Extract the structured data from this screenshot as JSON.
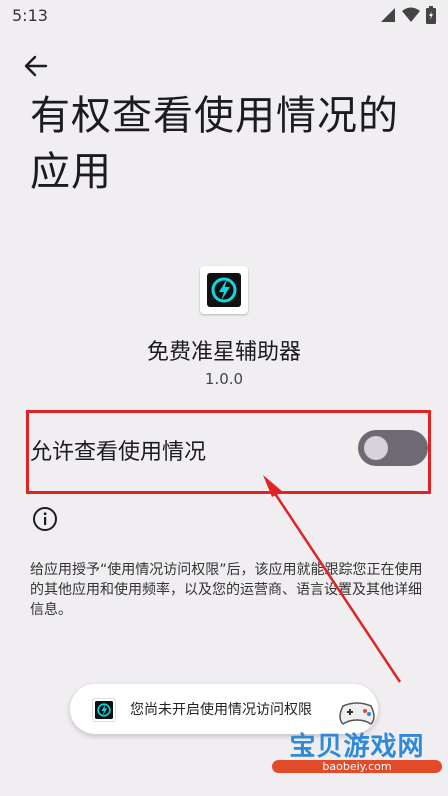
{
  "status_bar": {
    "time": "5:13"
  },
  "header": {
    "title": "有权查看使用情况的应用"
  },
  "app": {
    "name": "免费准星辅助器",
    "version": "1.0.0"
  },
  "setting": {
    "label": "允许查看使用情况",
    "enabled": false
  },
  "description": "给应用授予“使用情况访问权限”后，该应用就能跟踪您正在使用的其他应用和使用频率，以及您的运营商、语言设置及其他详细信息。",
  "toast": {
    "text": "您尚未开启使用情况访问权限"
  },
  "watermark": {
    "name": "宝贝游戏网",
    "url": "baobeiy.com"
  },
  "colors": {
    "annotation_red": "#e02424",
    "toggle_off": "#6d6a73",
    "background": "#f1eef2",
    "app_icon_teal": "#10d6e0"
  }
}
